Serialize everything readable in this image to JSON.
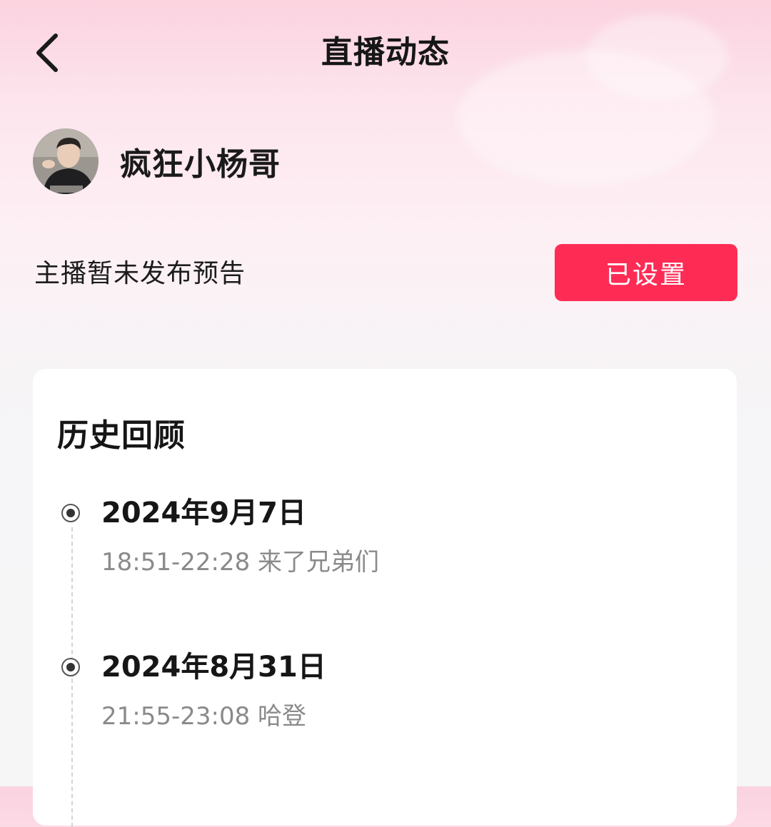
{
  "header": {
    "title": "直播动态",
    "back_icon": "chevron-left-icon"
  },
  "profile": {
    "name": "疯狂小杨哥"
  },
  "preview": {
    "notice": "主播暂未发布预告",
    "button_label": "已设置",
    "button_color": "#fe2c55"
  },
  "history": {
    "title": "历史回顾",
    "entries": [
      {
        "date": "2024年9月7日",
        "desc": "18:51-22:28 来了兄弟们"
      },
      {
        "date": "2024年8月31日",
        "desc": "21:55-23:08 哈登"
      }
    ]
  }
}
